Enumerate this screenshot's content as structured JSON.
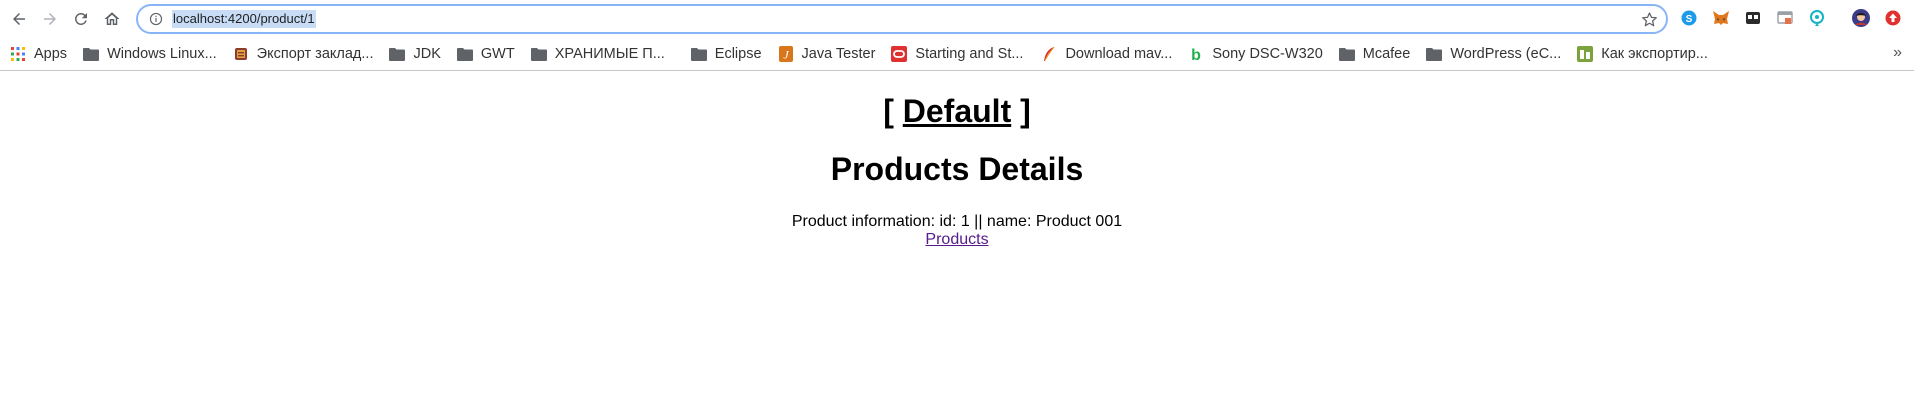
{
  "browser": {
    "url": "localhost:4200/product/1",
    "extensions": [
      {
        "icon": "skype-icon",
        "color": "#1e9be8"
      },
      {
        "icon": "metamask-fox-icon",
        "color": "#e2761b"
      },
      {
        "icon": "tab-manager-icon",
        "color": "#333333"
      },
      {
        "icon": "window-extension-icon",
        "color": "#9aa0a6"
      },
      {
        "icon": "location-pin-extension-icon",
        "color": "#17b3c4"
      },
      {
        "icon": "profile-avatar-icon",
        "color": "#3b3b8c"
      },
      {
        "icon": "upload-red-icon",
        "color": "#e03131"
      }
    ]
  },
  "bookmarks": [
    {
      "label": "Apps",
      "icon": "apps-grid-icon"
    },
    {
      "label": "Windows Linux...",
      "icon": "folder-icon"
    },
    {
      "label": "Экспорт заклад...",
      "icon": "book-favicon-icon"
    },
    {
      "label": "JDK",
      "icon": "folder-icon"
    },
    {
      "label": "GWT",
      "icon": "folder-icon"
    },
    {
      "label": "ХРАНИМЫЕ П...",
      "icon": "folder-icon"
    },
    {
      "label": "Eclipse",
      "icon": "folder-icon"
    },
    {
      "label": "Java Tester",
      "icon": "java-favicon-icon"
    },
    {
      "label": "Starting and St...",
      "icon": "oracle-favicon-icon"
    },
    {
      "label": "Download mav...",
      "icon": "feather-favicon-icon"
    },
    {
      "label": "Sony DSC-W320",
      "icon": "b-favicon-icon"
    },
    {
      "label": "Mcafee",
      "icon": "folder-icon"
    },
    {
      "label": "WordPress (eC...",
      "icon": "folder-icon"
    },
    {
      "label": "Как экспортир...",
      "icon": "spreadsheet-favicon-icon"
    }
  ],
  "page": {
    "title_prefix": "[ ",
    "title_link": "Default",
    "title_suffix": " ]",
    "heading": "Products Details",
    "product_info": "Product information: id: 1 || name: Product 001",
    "products_link": "Products"
  }
}
